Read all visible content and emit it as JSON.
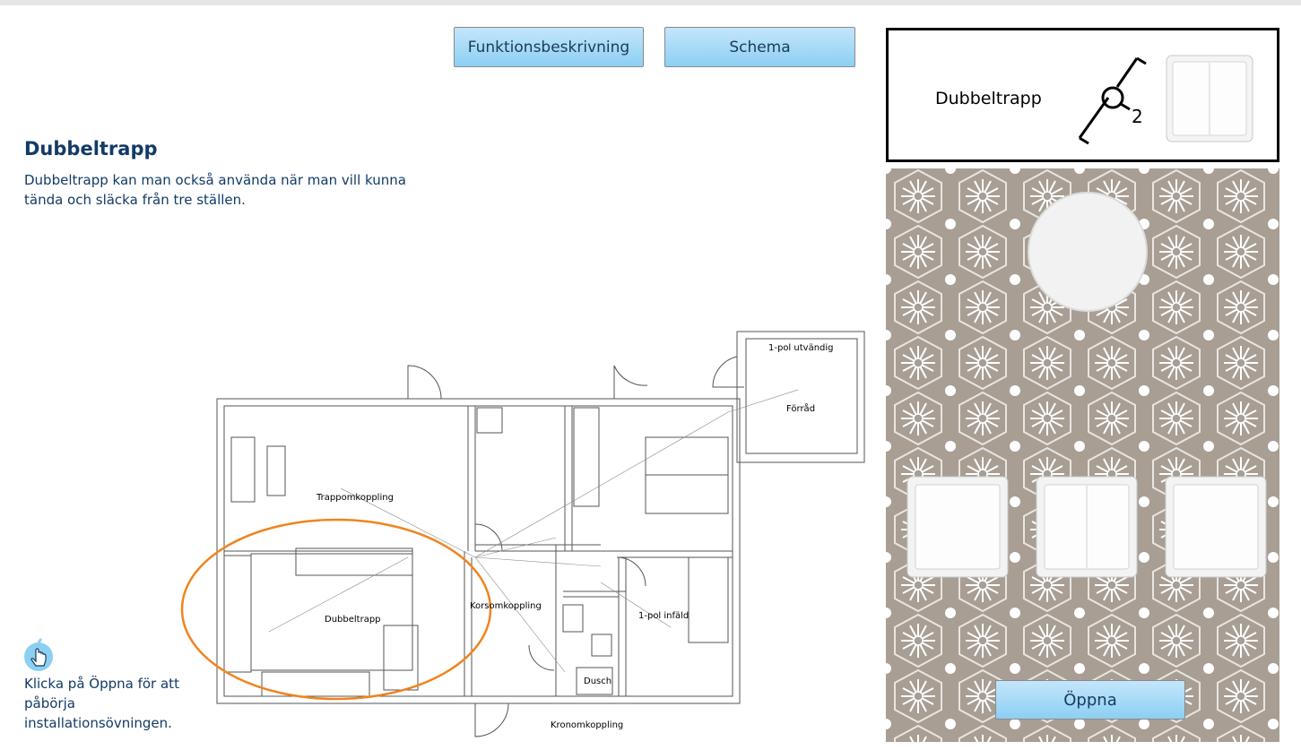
{
  "buttons": {
    "function_description": "Funktionsbeskrivning",
    "schema": "Schema",
    "open": "Öppna"
  },
  "info": {
    "title": "Dubbeltrapp",
    "description": "Dubbeltrapp kan man också använda när man vill kunna tända och släcka från tre ställen.",
    "hint": "Klicka på Öppna för att påbörja installationsövningen."
  },
  "symbol_panel": {
    "label": "Dubbeltrapp",
    "symbol_number": "2"
  },
  "floorplan": {
    "labels": {
      "trappomkoppling": "Trappomkoppling",
      "dubbeltrapp": "Dubbeltrapp",
      "korsomkoppling": "Korsomkoppling",
      "kronomkoppling": "Kronomkoppling",
      "enpol_infald": "1-pol infäld",
      "enpol_utvandig": "1-pol utvändig",
      "forrad": "Förråd",
      "dusch": "Dusch"
    }
  },
  "colors": {
    "accent_title": "#123b66",
    "button_top": "#c4e6fb",
    "button_bottom": "#8ccff3",
    "highlight_ellipse": "#f0841e",
    "wallpaper_bg": "#a89e94"
  },
  "icons": {
    "hand": "pointer-hand-icon",
    "switch": "light-switch-icon"
  }
}
